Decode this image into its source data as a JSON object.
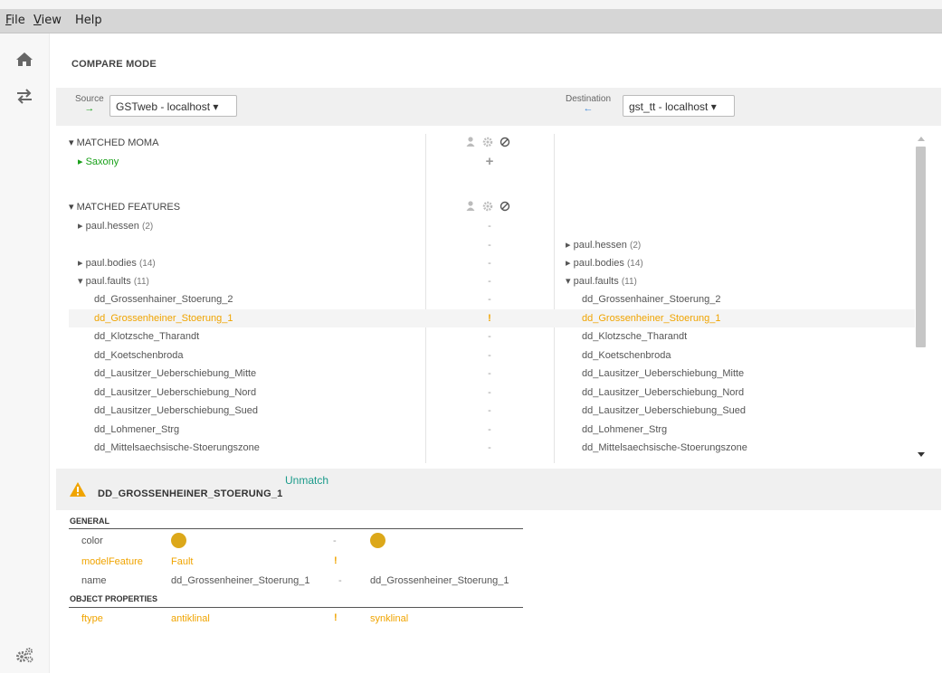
{
  "menu": {
    "file_u": "F",
    "file_rest": "ile",
    "view_u": "V",
    "view_rest": "iew",
    "help": "Help"
  },
  "sidebar": {
    "icons": [
      "home-icon",
      "compare-arrows-icon",
      "settings-gears-icon"
    ]
  },
  "mode_title": "COMPARE MODE",
  "source": {
    "label": "Source",
    "arrow": "→",
    "value": "GSTweb - localhost ▾"
  },
  "destination": {
    "label": "Destination",
    "arrow": "←",
    "value": "gst_tt - localhost ▾"
  },
  "tree": {
    "matched_moma": {
      "header": "▾ MATCHED MOMA",
      "item": "▸ Saxony",
      "item_action": "+"
    },
    "matched_features": {
      "header": "▾ MATCHED FEATURES"
    },
    "left_groups": [
      {
        "arrow": "▸",
        "name": "paul.hessen",
        "count": "(2)"
      },
      {
        "arrow": "▸",
        "name": "paul.bodies",
        "count": "(14)"
      },
      {
        "arrow": "▾",
        "name": "paul.faults",
        "count": "(11)"
      }
    ],
    "right_groups": [
      {
        "arrow": "▸",
        "name": "paul.hessen",
        "count": "(2)"
      },
      {
        "arrow": "▸",
        "name": "paul.bodies",
        "count": "(14)"
      },
      {
        "arrow": "▾",
        "name": "paul.faults",
        "count": "(11)"
      }
    ],
    "faults": [
      {
        "left": "dd_Grossenhainer_Stoerung_2",
        "mid": "-",
        "right": "dd_Grossenhainer_Stoerung_2"
      },
      {
        "left": "dd_Grossenheiner_Stoerung_1",
        "mid": "!",
        "right": "dd_Grossenheiner_Stoerung_1"
      },
      {
        "left": "dd_Klotzsche_Tharandt",
        "mid": "-",
        "right": "dd_Klotzsche_Tharandt"
      },
      {
        "left": "dd_Koetschenbroda",
        "mid": "-",
        "right": "dd_Koetschenbroda"
      },
      {
        "left": "dd_Lausitzer_Ueberschiebung_Mitte",
        "mid": "-",
        "right": "dd_Lausitzer_Ueberschiebung_Mitte"
      },
      {
        "left": "dd_Lausitzer_Ueberschiebung_Nord",
        "mid": "-",
        "right": "dd_Lausitzer_Ueberschiebung_Nord"
      },
      {
        "left": "dd_Lausitzer_Ueberschiebung_Sued",
        "mid": "-",
        "right": "dd_Lausitzer_Ueberschiebung_Sued"
      },
      {
        "left": "dd_Lohmener_Strg",
        "mid": "-",
        "right": "dd_Lohmener_Strg"
      },
      {
        "left": "dd_Mittelsaechsische-Stoerungszone",
        "mid": "-",
        "right": "dd_Mittelsaechsische-Stoerungszone"
      }
    ],
    "group_mid": [
      "-",
      "-",
      "-",
      "-"
    ]
  },
  "detail": {
    "title": "DD_GROSSENHEINER_STOERUNG_1",
    "unmatch": "Unmatch",
    "general": "GENERAL",
    "object_properties": "OBJECT PROPERTIES",
    "rows": [
      {
        "key": "color",
        "left": "",
        "mid": "-",
        "right": ""
      },
      {
        "key": "modelFeature",
        "left": "Fault",
        "mid": "!",
        "right": ""
      },
      {
        "key": "name",
        "left": "dd_Grossenheiner_Stoerung_1",
        "mid": "-",
        "right": "dd_Grossenheiner_Stoerung_1"
      },
      {
        "key": "ftype",
        "left": "antiklinal",
        "mid": "!",
        "right": "synklinal"
      }
    ]
  },
  "colors": {
    "accent_orange": "#f0a400",
    "green": "#1aa01a",
    "teal": "#1a9a8a",
    "dot": "#dca81a"
  }
}
